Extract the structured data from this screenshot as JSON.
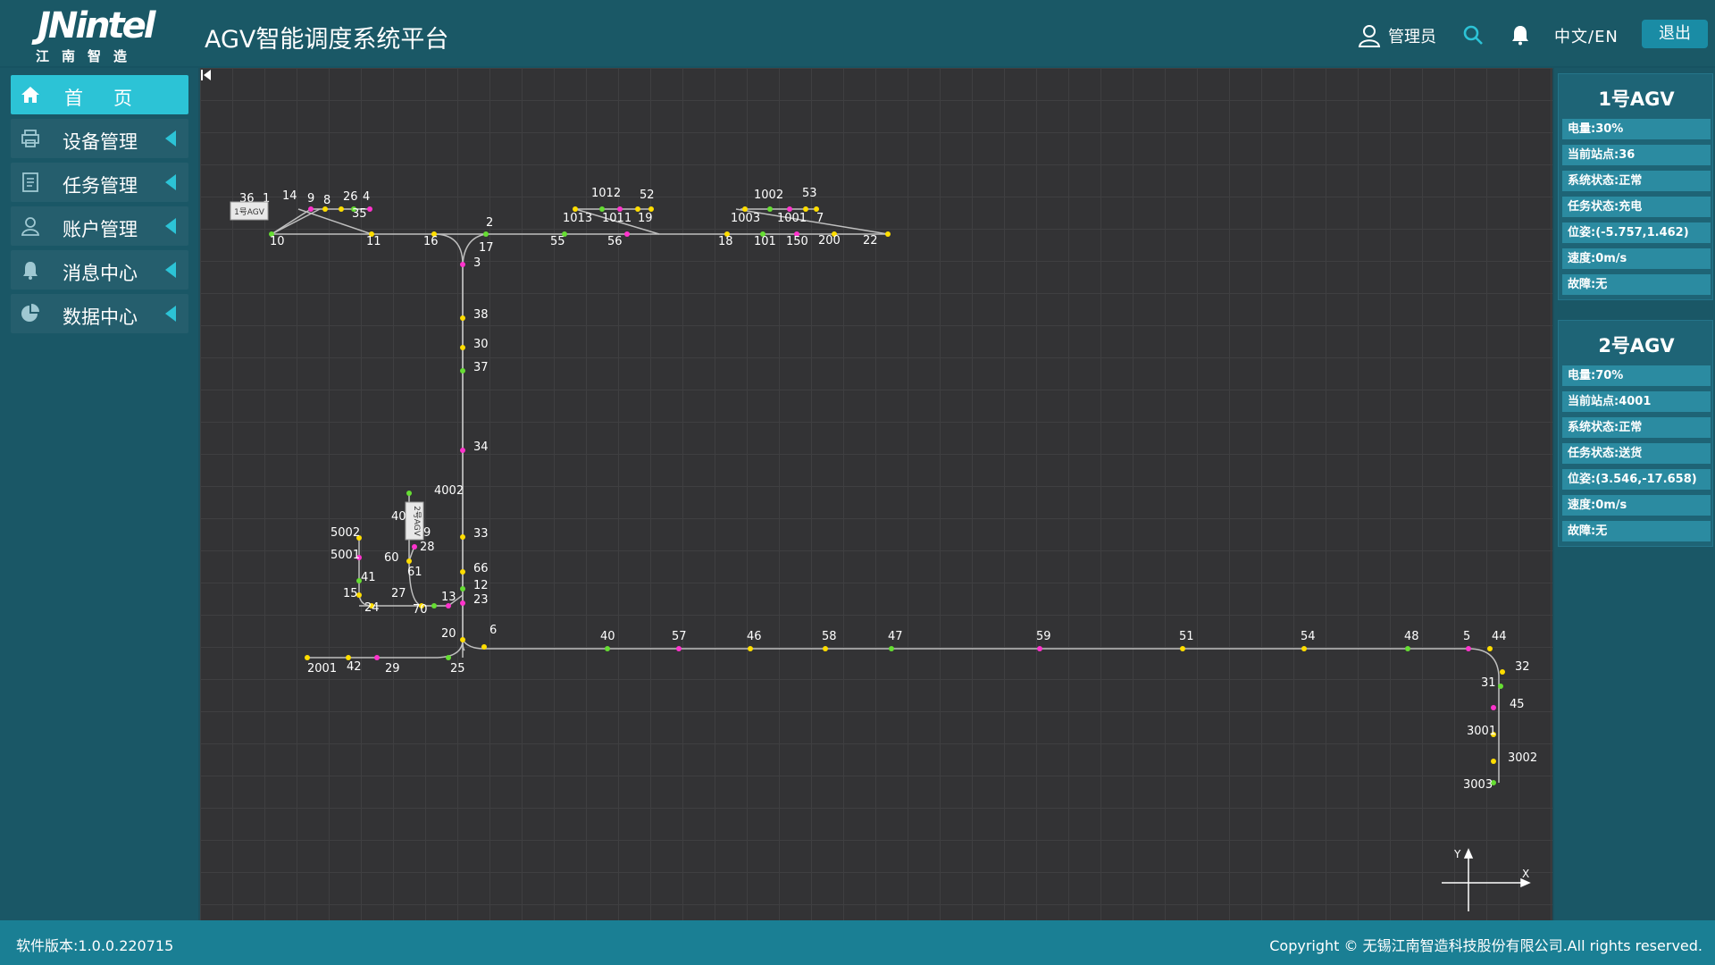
{
  "header": {
    "logo_text": "JNintel",
    "logo_sub": "江南智造",
    "title": "AGV智能调度系统平台",
    "user_name": "管理员",
    "lang_switch": "中文/EN",
    "logout_label": "退出",
    "icons": {
      "user": "user-icon",
      "search": "search-icon",
      "bell": "bell-icon"
    },
    "accent_color": "#2cc3d6"
  },
  "sidebar": {
    "items": [
      {
        "label": "首页",
        "icon": "home-icon",
        "active": true
      },
      {
        "label": "设备管理",
        "icon": "printer-icon",
        "active": false
      },
      {
        "label": "任务管理",
        "icon": "document-icon",
        "active": false
      },
      {
        "label": "账户管理",
        "icon": "user-icon",
        "active": false
      },
      {
        "label": "消息中心",
        "icon": "bell-icon",
        "active": false
      },
      {
        "label": "数据中心",
        "icon": "pie-chart-icon",
        "active": false
      }
    ]
  },
  "map": {
    "agv_labels": [
      "1号AGV",
      "2号AGV"
    ],
    "axis_labels": {
      "x": "X",
      "y": "Y"
    },
    "stations": [
      "36",
      "1",
      "14",
      "9",
      "8",
      "26",
      "4",
      "35",
      "10",
      "11",
      "16",
      "2",
      "17",
      "3",
      "38",
      "30",
      "37",
      "34",
      "33",
      "66",
      "12",
      "23",
      "13",
      "20",
      "6",
      "25",
      "29",
      "42",
      "2001",
      "4002",
      "400",
      "9",
      "28",
      "60",
      "61",
      "27",
      "70",
      "24",
      "15",
      "41",
      "5001",
      "5002",
      "1012",
      "52",
      "1013",
      "1011",
      "19",
      "55",
      "56",
      "1002",
      "53",
      "1003",
      "1001",
      "7",
      "18",
      "101",
      "150",
      "200",
      "22",
      "40",
      "57",
      "46",
      "58",
      "47",
      "59",
      "51",
      "54",
      "48",
      "5",
      "44",
      "32",
      "31",
      "45",
      "3001",
      "3002",
      "3003"
    ]
  },
  "agvs": [
    {
      "title": "1号AGV",
      "rows": [
        "电量:30%",
        "当前站点:36",
        "系统状态:正常",
        "任务状态:充电",
        "位姿:(-5.757,1.462)",
        "速度:0m/s",
        "故障:无"
      ]
    },
    {
      "title": "2号AGV",
      "rows": [
        "电量:70%",
        "当前站点:4001",
        "系统状态:正常",
        "任务状态:送货",
        "位姿:(3.546,-17.658)",
        "速度:0m/s",
        "故障:无"
      ]
    }
  ],
  "footer": {
    "version": "软件版本:1.0.0.220715",
    "copyright": "Copyright © 无锡江南智造科技股份有限公司.All rights reserved."
  }
}
